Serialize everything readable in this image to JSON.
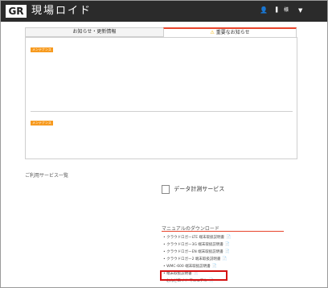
{
  "header": {
    "logo_badge": "GR",
    "logo_text": "現場ロイド",
    "user_name": "▌",
    "user_suffix": "様"
  },
  "tabs": [
    {
      "label": "お知らせ・更新情報"
    },
    {
      "label": "重要なお知らせ"
    }
  ],
  "notices": [
    {
      "badge": "メンテナンス"
    },
    {
      "badge": "メンテナンス"
    }
  ],
  "services": {
    "title": "ご利用サービス一覧",
    "items": [
      {
        "label": "データ計測サービス"
      }
    ]
  },
  "downloads": {
    "title": "マニュアルのダウンロード",
    "items": [
      {
        "label": "クラウドロガーLTE 端末取扱説明書"
      },
      {
        "label": "クラウドロガー3G 端末取扱説明書"
      },
      {
        "label": "クラウドロガーEN 端末取扱説明書"
      },
      {
        "label": "クラウドロガー2 端末取扱説明書"
      },
      {
        "label": "WMC-600 端末取扱説明書"
      },
      {
        "label": "端末取扱説明書"
      },
      {
        "label": "おんどロイド マニュアル"
      }
    ]
  },
  "colors": {
    "accent": "#e8452c",
    "badge": "#f79a1e",
    "highlight": "#d51212"
  }
}
